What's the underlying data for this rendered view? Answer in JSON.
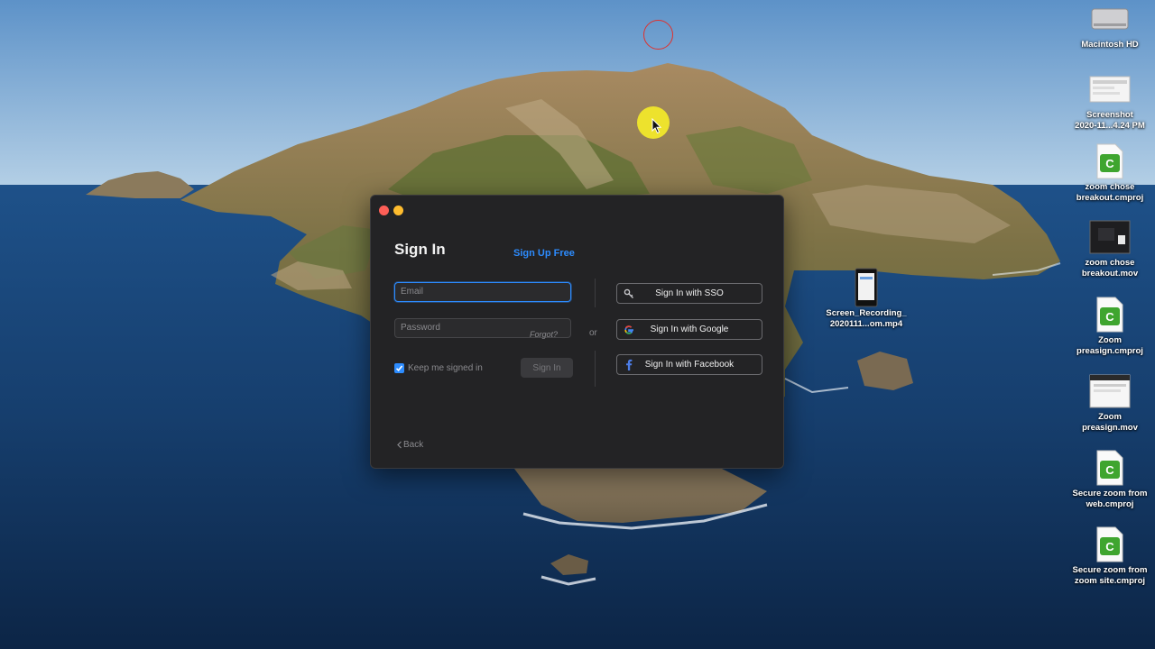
{
  "desktop": {
    "icons": [
      {
        "name": "macintosh-hd-icon",
        "label": "Macintosh HD",
        "type": "disk"
      },
      {
        "name": "screenshot-file-icon",
        "label": "Screenshot\n2020-11...4.24 PM",
        "type": "screenshot"
      },
      {
        "name": "zoom-chose-breakout-cmproj-icon",
        "label": "zoom chose\nbreakout.cmproj",
        "type": "cmproj"
      },
      {
        "name": "zoom-chose-breakout-mov-icon",
        "label": "zoom chose\nbreakout.mov",
        "type": "movie"
      },
      {
        "name": "screen-recording-mp4-icon",
        "label": "Screen_Recording_\n2020111...om.mp4",
        "type": "phone-video"
      },
      {
        "name": "zoom-preasign-cmproj-icon",
        "label": "Zoom\npreasign.cmproj",
        "type": "cmproj"
      },
      {
        "name": "zoom-preasign-mov-icon",
        "label": "Zoom\npreasign.mov",
        "type": "movie"
      },
      {
        "name": "secure-zoom-web-cmproj-icon",
        "label": "Secure zoom from\nweb.cmproj",
        "type": "cmproj"
      },
      {
        "name": "secure-zoom-site-cmproj-icon",
        "label": "Secure zoom from\nzoom site.cmproj",
        "type": "cmproj"
      }
    ]
  },
  "zoom_window": {
    "title": "Sign In",
    "signup_link": "Sign Up Free",
    "email_placeholder": "Email",
    "password_placeholder": "Password",
    "forgot_label": "Forgot?",
    "keep_signed_in": {
      "label": "Keep me signed in",
      "checked": true
    },
    "signin_button": "Sign In",
    "or_label": "or",
    "sso_button": "Sign In with SSO",
    "google_button": "Sign In with Google",
    "facebook_button": "Sign In with Facebook",
    "back_link": "Back"
  },
  "colors": {
    "accent": "#2d8cff",
    "window_bg": "#232325",
    "close": "#fe5f57",
    "minimize": "#febc2e",
    "click_highlight": "#f3ea2a",
    "annotation_circle": "#e0302c"
  }
}
